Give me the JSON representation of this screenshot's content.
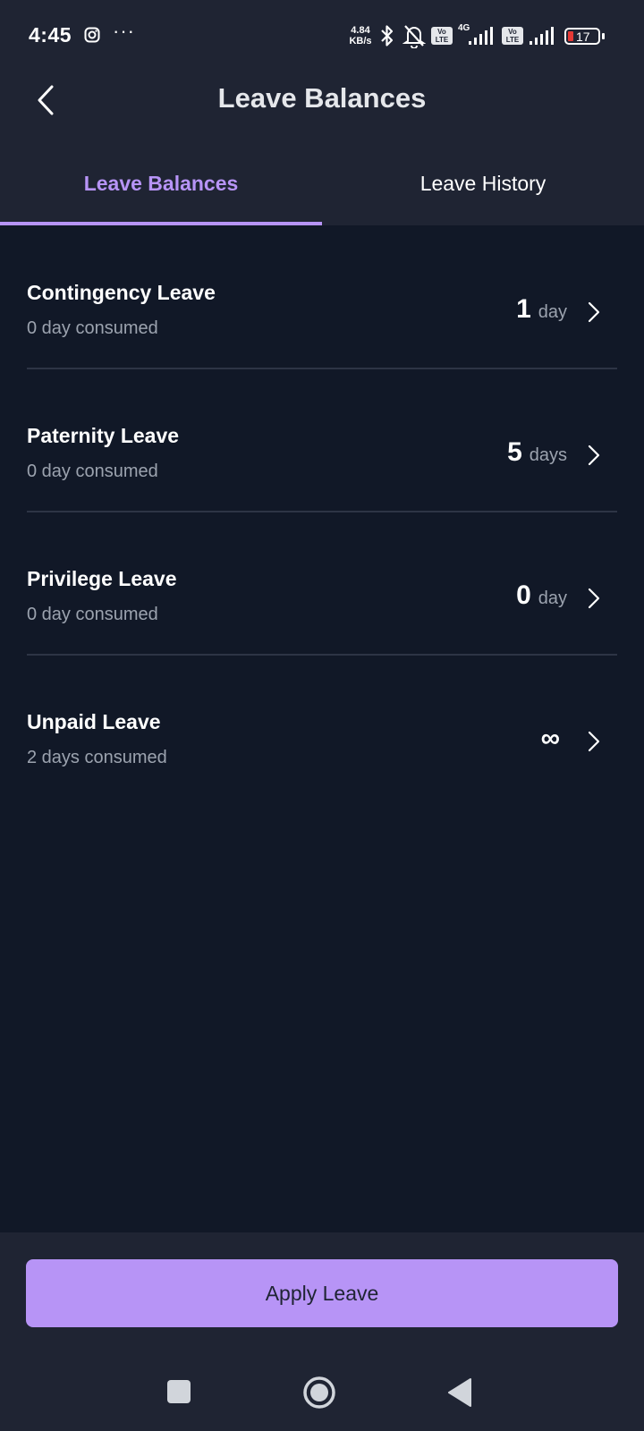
{
  "status_bar": {
    "time": "4:45",
    "speed_value": "4.84",
    "speed_unit": "KB/s",
    "network": "4G",
    "volte_top": "Vo",
    "volte_bottom": "LTE",
    "battery": "17",
    "icons": [
      "instagram-icon",
      "more-dots-icon",
      "bluetooth-icon",
      "bell-off-icon",
      "volte-icon",
      "signal-icon",
      "battery-icon"
    ]
  },
  "header": {
    "title": "Leave Balances",
    "back_icon": "chevron-left-icon"
  },
  "tabs": [
    {
      "label": "Leave Balances",
      "active": true
    },
    {
      "label": "Leave History",
      "active": false
    }
  ],
  "leaves": [
    {
      "name": "Contingency Leave",
      "consumed": "0 day consumed",
      "balance": "1",
      "unit": "day"
    },
    {
      "name": "Paternity Leave",
      "consumed": "0 day consumed",
      "balance": "5",
      "unit": "days"
    },
    {
      "name": "Privilege Leave",
      "consumed": "0 day consumed",
      "balance": "0",
      "unit": "day"
    },
    {
      "name": "Unpaid Leave",
      "consumed": "2 days consumed",
      "balance": "∞",
      "unit": ""
    }
  ],
  "actions": {
    "apply_label": "Apply Leave"
  },
  "colors": {
    "accent": "#b794f6",
    "header_bg": "#1f2433",
    "page_bg": "#111827",
    "muted_text": "#9ca3af"
  },
  "nav_bar": [
    "recents-square-icon",
    "home-circle-icon",
    "back-triangle-icon"
  ]
}
